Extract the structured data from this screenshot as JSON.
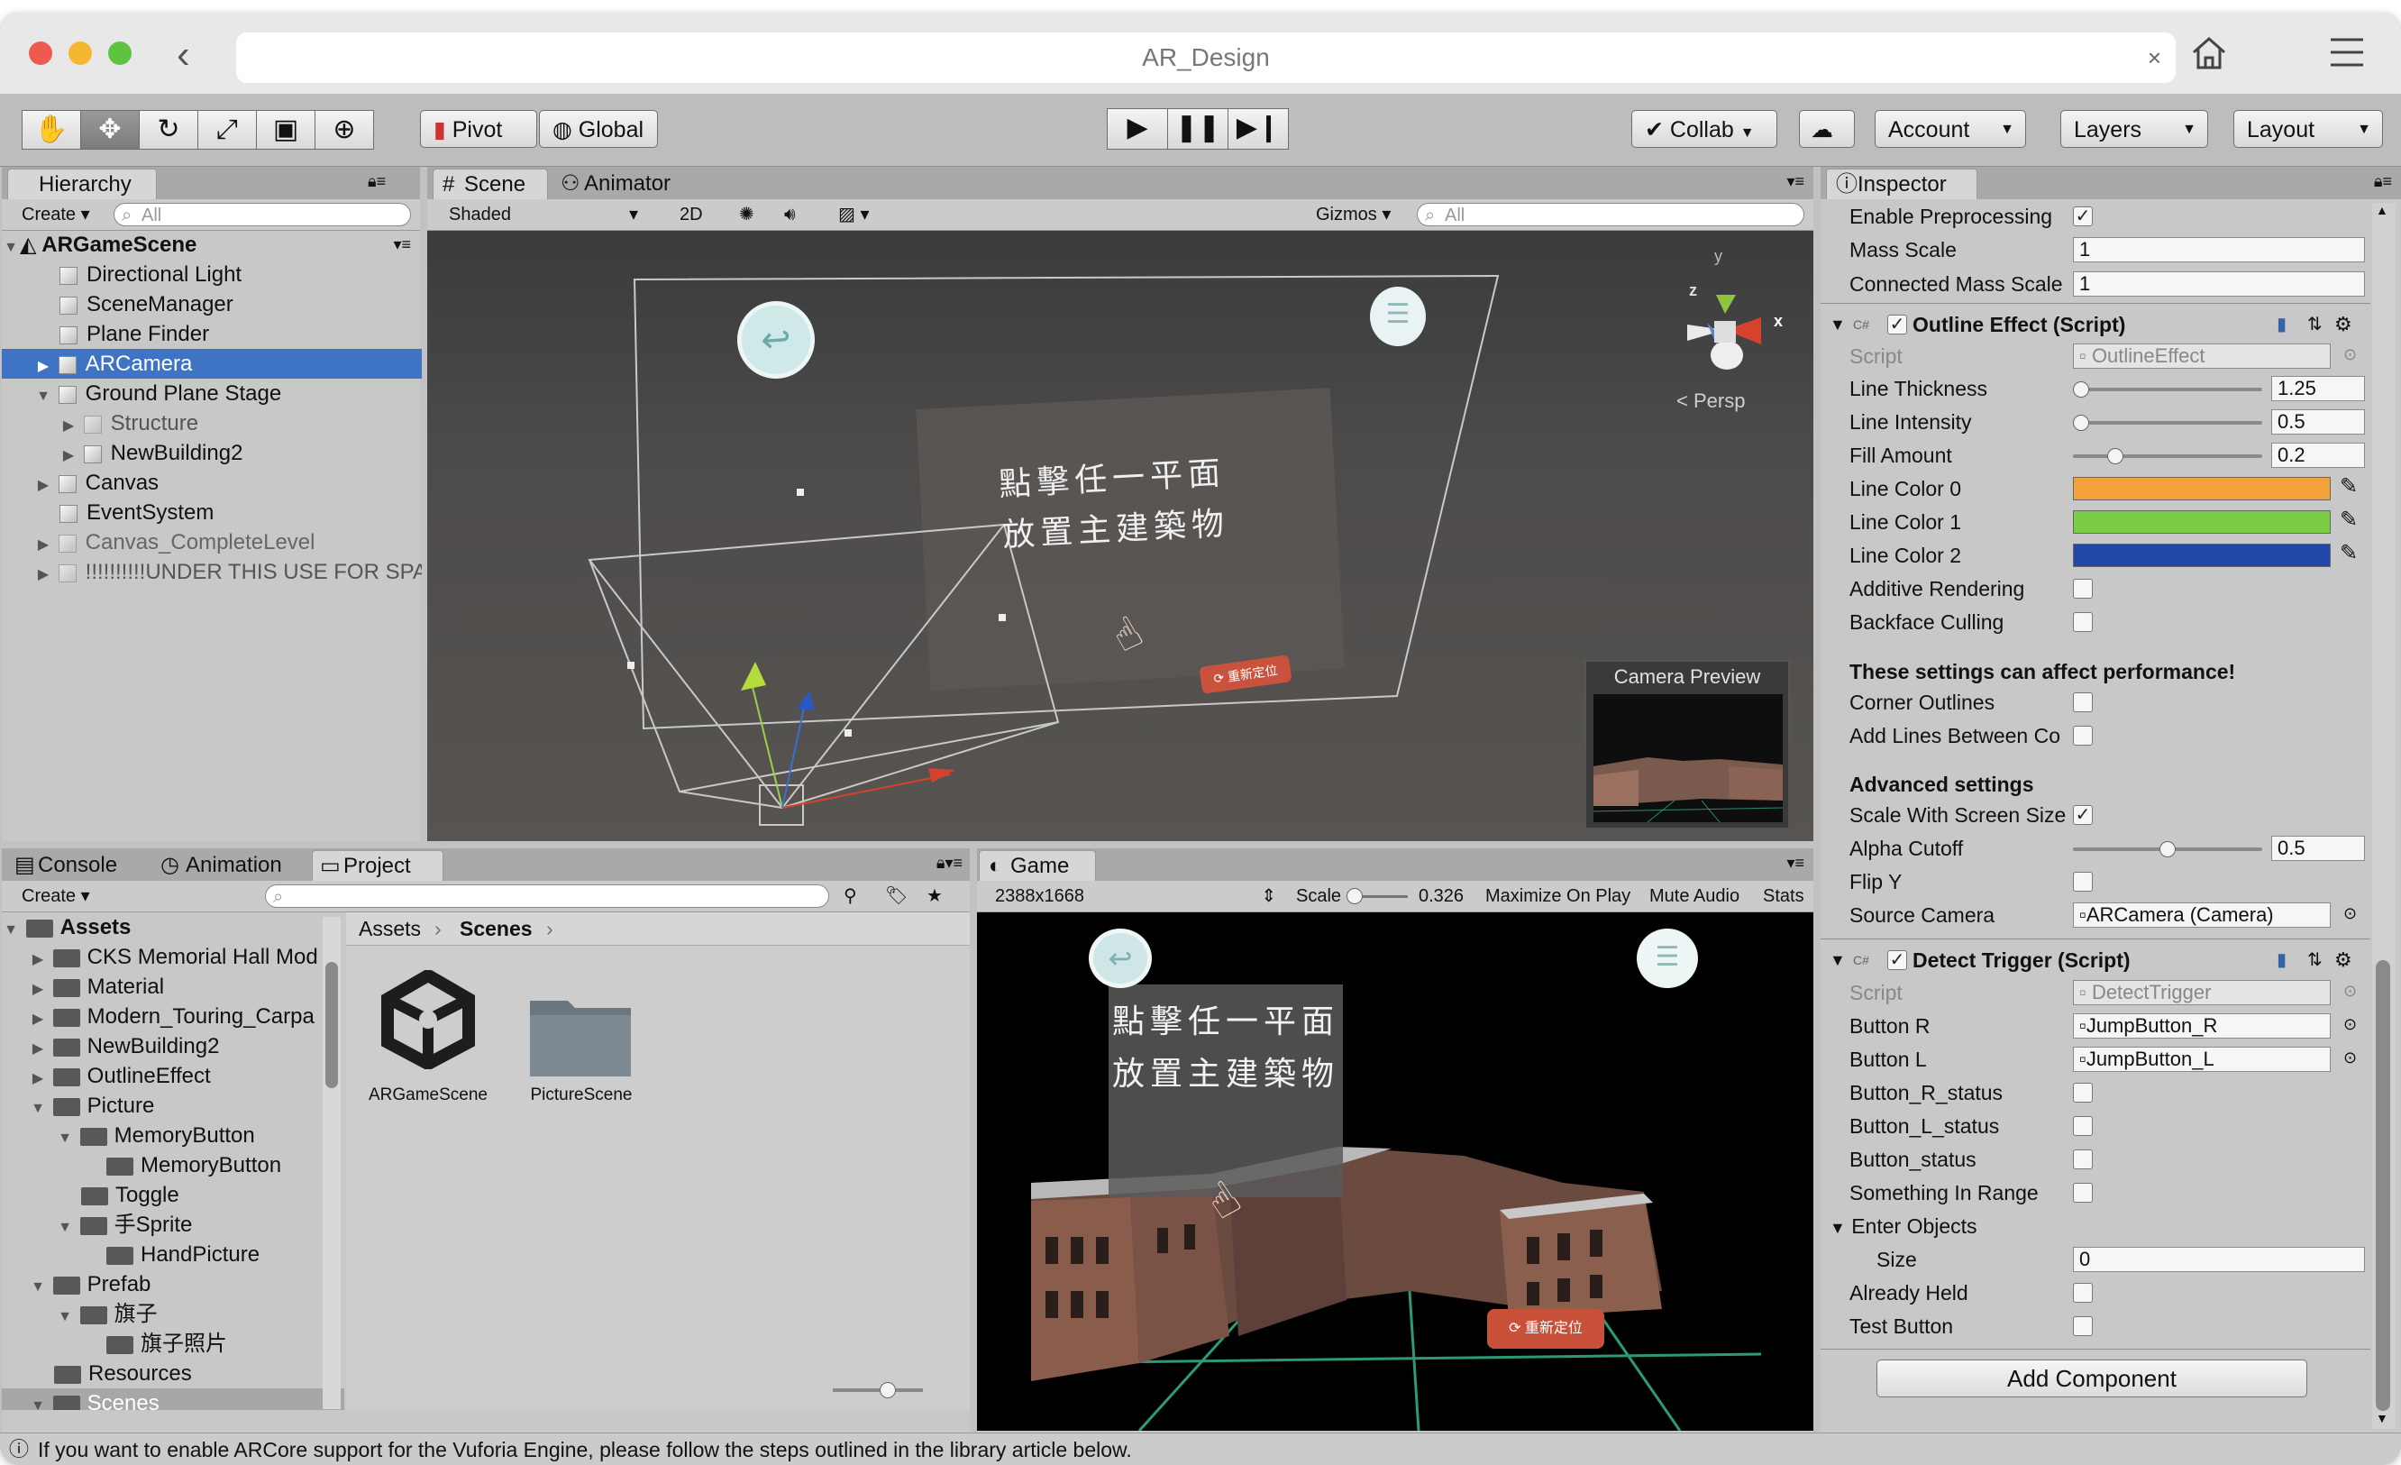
{
  "window": {
    "url_text": "AR_Design"
  },
  "toolbar": {
    "pivot_label": "Pivot",
    "global_label": "Global",
    "collab_label": "Collab",
    "account_label": "Account",
    "layers_label": "Layers",
    "layout_label": "Layout"
  },
  "hierarchy": {
    "tab_label": "Hierarchy",
    "create_label": "Create",
    "search_placeholder": "All",
    "scene_name": "ARGameScene",
    "items": [
      {
        "label": "Directional Light"
      },
      {
        "label": "SceneManager"
      },
      {
        "label": "Plane Finder"
      },
      {
        "label": "ARCamera"
      },
      {
        "label": "Ground Plane Stage"
      },
      {
        "label": "Structure"
      },
      {
        "label": "NewBuilding2"
      },
      {
        "label": "Canvas"
      },
      {
        "label": "EventSystem"
      },
      {
        "label": "Canvas_CompleteLevel"
      },
      {
        "label": "!!!!!!!!!!UNDER THIS USE FOR SPA"
      }
    ]
  },
  "scene": {
    "tab_scene": "Scene",
    "tab_animator": "Animator",
    "shading_mode": "Shaded",
    "mode_2d": "2D",
    "gizmos_label": "Gizmos",
    "search_placeholder": "All",
    "persp_label": "Persp",
    "camera_preview_label": "Camera Preview",
    "overlay_line1": "點擊任一平面",
    "overlay_line2": "放置主建築物",
    "reset_button_label": "重新定位",
    "axis_y": "y",
    "axis_z": "z",
    "axis_x": "x"
  },
  "bottom_left": {
    "tab_console": "Console",
    "tab_animation": "Animation",
    "tab_project": "Project",
    "create_label": "Create",
    "tree": [
      {
        "label": "Assets"
      },
      {
        "label": "CKS Memorial Hall Mod"
      },
      {
        "label": "Material"
      },
      {
        "label": "Modern_Touring_Carpa"
      },
      {
        "label": "NewBuilding2"
      },
      {
        "label": "OutlineEffect"
      },
      {
        "label": "Picture"
      },
      {
        "label": "MemoryButton"
      },
      {
        "label": "MemoryButton"
      },
      {
        "label": "Toggle"
      },
      {
        "label": "手Sprite"
      },
      {
        "label": "HandPicture"
      },
      {
        "label": "Prefab"
      },
      {
        "label": "旗子"
      },
      {
        "label": "旗子照片"
      },
      {
        "label": "Resources"
      },
      {
        "label": "Scenes"
      }
    ],
    "breadcrumb_root": "Assets",
    "breadcrumb_current": "Scenes",
    "assets": [
      {
        "label": "ARGameScene"
      },
      {
        "label": "PictureScene"
      }
    ]
  },
  "game": {
    "tab_label": "Game",
    "resolution": "2388x1668",
    "scale_label": "Scale",
    "scale_value": "0.326",
    "maximize_label": "Maximize On Play",
    "mute_label": "Mute Audio",
    "stats_label": "Stats",
    "overlay_line1": "點擊任一平面",
    "overlay_line2": "放置主建築物",
    "reset_button_label": "重新定位"
  },
  "inspector": {
    "tab_label": "Inspector",
    "top_rows": [
      {
        "label": "Enable Preprocessing",
        "checked": true
      },
      {
        "label": "Mass Scale",
        "value": "1"
      },
      {
        "label": "Connected Mass Scale",
        "value": "1"
      }
    ],
    "outline": {
      "title": "Outline Effect (Script)",
      "script_label": "Script",
      "script_value": "OutlineEffect",
      "line_thickness_label": "Line Thickness",
      "line_thickness_value": "1.25",
      "line_thickness_fraction": 0.0,
      "line_intensity_label": "Line Intensity",
      "line_intensity_value": "0.5",
      "line_intensity_fraction": 0.0,
      "fill_amount_label": "Fill Amount",
      "fill_amount_value": "0.2",
      "fill_amount_fraction": 0.2,
      "line_color0_label": "Line Color 0",
      "line_color0": "#f3a13a",
      "line_color1_label": "Line Color 1",
      "line_color1": "#7ccd46",
      "line_color2_label": "Line Color 2",
      "line_color2": "#2347a8",
      "additive_label": "Additive Rendering",
      "backface_label": "Backface Culling",
      "perf_heading": "These settings can affect performance!",
      "corner_label": "Corner Outlines",
      "add_lines_label": "Add Lines Between Co",
      "advanced_heading": "Advanced settings",
      "scale_screen_label": "Scale With Screen Size",
      "alpha_cutoff_label": "Alpha Cutoff",
      "alpha_cutoff_value": "0.5",
      "alpha_cutoff_fraction": 0.5,
      "flip_y_label": "Flip Y",
      "source_camera_label": "Source Camera",
      "source_camera_value": "ARCamera (Camera)"
    },
    "detect": {
      "title": "Detect Trigger (Script)",
      "script_label": "Script",
      "script_value": "DetectTrigger",
      "button_r_label": "Button R",
      "button_r_value": "JumpButton_R",
      "button_l_label": "Button L",
      "button_l_value": "JumpButton_L",
      "button_r_status_label": "Button_R_status",
      "button_l_status_label": "Button_L_status",
      "button_status_label": "Button_status",
      "something_label": "Something In Range",
      "enter_objects_label": "Enter Objects",
      "size_label": "Size",
      "size_value": "0",
      "already_held_label": "Already Held",
      "test_button_label": "Test Button"
    },
    "add_component_label": "Add Component"
  },
  "status_bar": {
    "message": "If you want to enable ARCore support for the Vuforia Engine, please follow the steps outlined in the library article below."
  }
}
